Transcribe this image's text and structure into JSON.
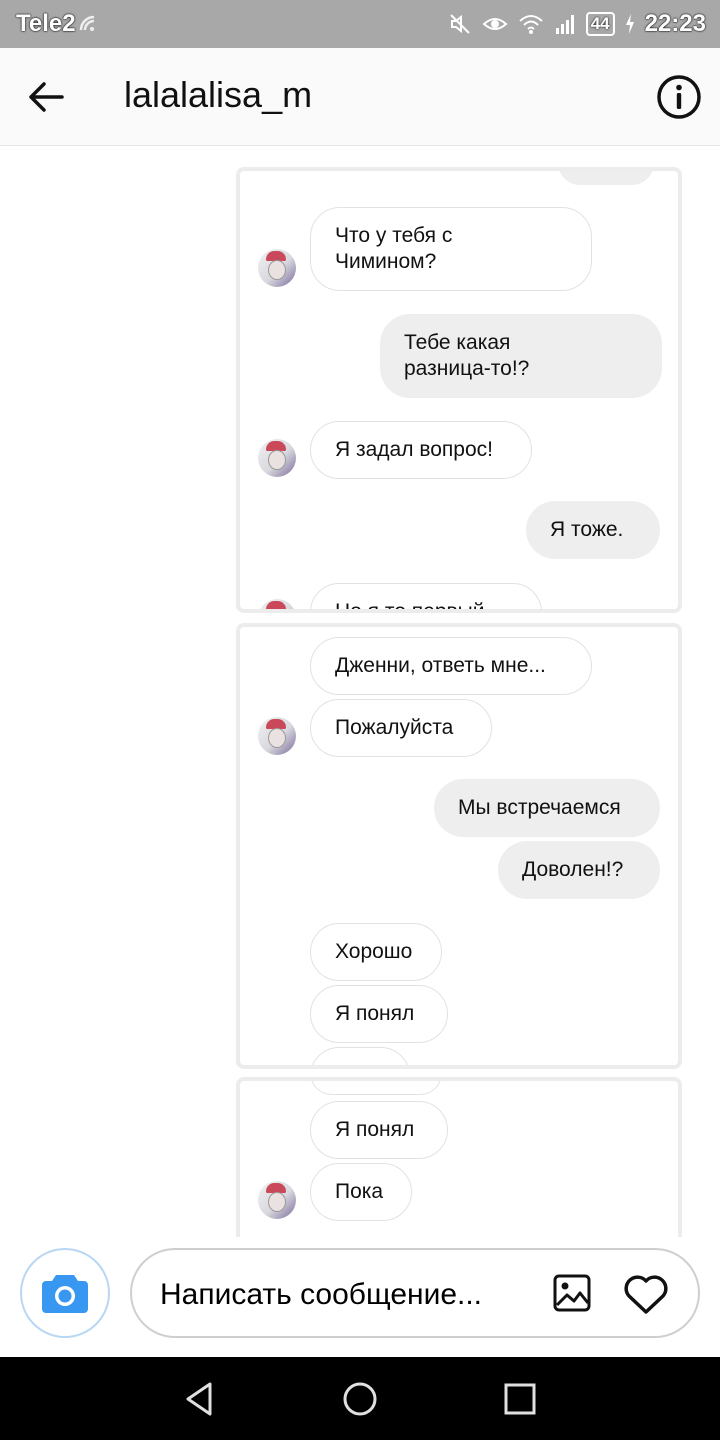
{
  "status_bar": {
    "carrier": "Tele2",
    "battery": "44",
    "time": "22:23",
    "icons": [
      "mute-icon",
      "eye-icon",
      "wifi-icon",
      "signal-icon",
      "battery-icon",
      "charging-icon"
    ]
  },
  "header": {
    "title": "lalalalisa_m",
    "back_icon": "arrow-left-icon",
    "info_icon": "info-icon"
  },
  "screenshots": [
    {
      "messages": [
        {
          "side": "in",
          "text": "Что у тебя с\nЧимином?"
        },
        {
          "side": "out",
          "text": "Тебе какая\nразница-то!?"
        },
        {
          "side": "in",
          "text": "Я задал вопрос!"
        },
        {
          "side": "out",
          "text": "Я тоже."
        },
        {
          "side": "in",
          "text": "Но я то первый"
        }
      ]
    },
    {
      "messages": [
        {
          "side": "in",
          "text": "Дженни, ответь мне..."
        },
        {
          "side": "in",
          "text": "Пожалуйста"
        },
        {
          "side": "out",
          "text": "Мы встречаемся"
        },
        {
          "side": "out",
          "text": "Доволен!?"
        },
        {
          "side": "in",
          "text": "Хорошо"
        },
        {
          "side": "in",
          "text": "Я понял"
        }
      ]
    },
    {
      "messages": [
        {
          "side": "in",
          "text": "Я понял"
        },
        {
          "side": "in",
          "text": "Пока"
        }
      ]
    }
  ],
  "composer": {
    "placeholder": "Написать сообщение...",
    "camera_icon": "camera-icon",
    "gallery_icon": "image-icon",
    "like_icon": "heart-icon"
  },
  "navbar": {
    "icons": [
      "back-triangle-icon",
      "home-circle-icon",
      "recents-square-icon"
    ]
  },
  "colors": {
    "status_bar": "#a8a8a8",
    "camera_accent": "#3897f0",
    "outgoing_bubble": "#eeeeee",
    "nav_bar": "#000000"
  }
}
